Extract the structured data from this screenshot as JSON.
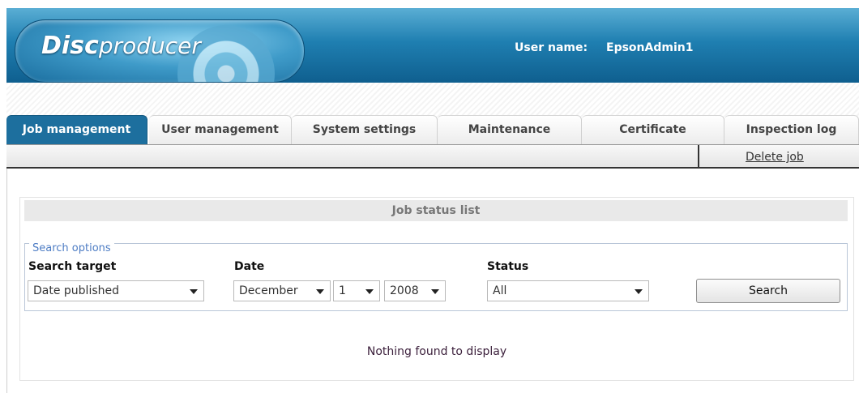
{
  "header": {
    "logo_main": "Disc",
    "logo_sub": "producer",
    "user_label": "User name:",
    "user_value": "EpsonAdmin1"
  },
  "tabs": [
    {
      "label": "Job management",
      "active": true
    },
    {
      "label": "User management",
      "active": false
    },
    {
      "label": "System settings",
      "active": false
    },
    {
      "label": "Maintenance",
      "active": false
    },
    {
      "label": "Certificate",
      "active": false
    },
    {
      "label": "Inspection log",
      "active": false
    }
  ],
  "toolbar": {
    "delete_link": "Delete job"
  },
  "panel": {
    "title": "Job status list",
    "search_legend": "Search options",
    "search_target_label": "Search target",
    "search_target_value": "Date published",
    "date_label": "Date",
    "month_value": "December",
    "day_value": "1",
    "year_value": "2008",
    "status_label": "Status",
    "status_value": "All",
    "search_button": "Search",
    "empty_message": "Nothing found to display"
  },
  "colors": {
    "header_blue": "#1f7fb1",
    "active_tab": "#1d6f9e",
    "legend_blue": "#4d7cc4"
  },
  "icons": [
    "disc-icon",
    "dropdown-arrow-icon"
  ]
}
